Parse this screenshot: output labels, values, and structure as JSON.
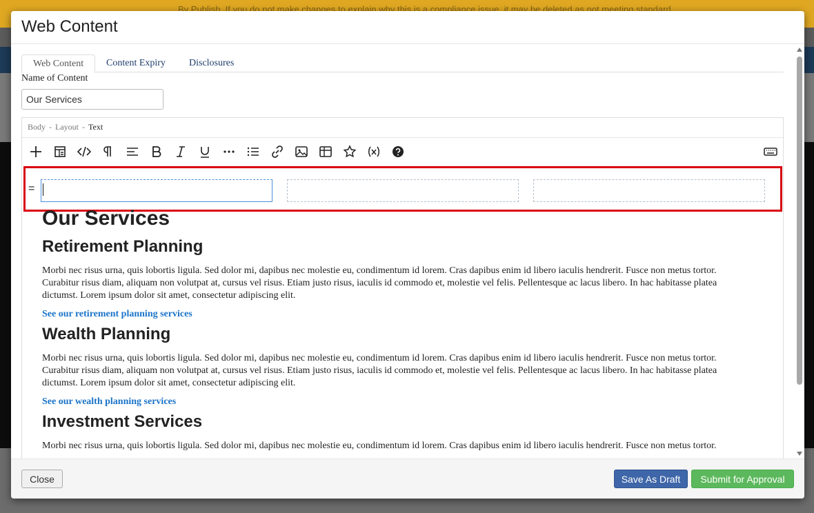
{
  "background": {
    "banner_text": "By Publish. If you do not make changes to explain why this is a compliance issue, it may be deleted as not meeting standard."
  },
  "modal": {
    "title": "Web Content"
  },
  "tabs": [
    {
      "label": "Web Content",
      "active": true
    },
    {
      "label": "Content Expiry",
      "active": false
    },
    {
      "label": "Disclosures",
      "active": false
    }
  ],
  "form": {
    "name_label": "Name of Content",
    "name_value": "Our Services"
  },
  "editor": {
    "breadcrumb": [
      "Body",
      "Layout",
      "Text"
    ],
    "toolbar": [
      "plus-icon",
      "layout-icon",
      "code-icon",
      "paragraph-icon",
      "align-icon",
      "bold-icon",
      "italic-icon",
      "underline-icon",
      "more-icon",
      "list-icon",
      "link-icon",
      "image-icon",
      "table-icon",
      "star-icon",
      "variable-icon",
      "help-icon",
      "keyboard-icon"
    ],
    "drag_handle": "="
  },
  "content": {
    "title": "Our Services",
    "sections": [
      {
        "heading": "Retirement Planning",
        "body": "Morbi nec risus urna, quis lobortis ligula. Sed dolor mi, dapibus nec molestie eu, condimentum id lorem. Cras dapibus enim id libero iaculis hendrerit. Fusce non metus tortor. Curabitur risus diam, aliquam non volutpat at, cursus vel risus. Etiam justo risus, iaculis id commodo et, molestie vel felis. Pellentesque ac lacus libero. In hac habitasse platea dictumst. Lorem ipsum dolor sit amet, consectetur adipiscing elit.",
        "link": "See our retirement planning services"
      },
      {
        "heading": "Wealth Planning",
        "body": "Morbi nec risus urna, quis lobortis ligula. Sed dolor mi, dapibus nec molestie eu, condimentum id lorem. Cras dapibus enim id libero iaculis hendrerit. Fusce non metus tortor. Curabitur risus diam, aliquam non volutpat at, cursus vel risus. Etiam justo risus, iaculis id commodo et, molestie vel felis. Pellentesque ac lacus libero. In hac habitasse platea dictumst. Lorem ipsum dolor sit amet, consectetur adipiscing elit.",
        "link": "See our wealth planning services"
      },
      {
        "heading": "Investment Services",
        "body": "Morbi nec risus urna, quis lobortis ligula. Sed dolor mi, dapibus nec molestie eu, condimentum id lorem. Cras dapibus enim id libero iaculis hendrerit. Fusce non metus tortor."
      }
    ]
  },
  "footer": {
    "close_label": "Close",
    "draft_label": "Save As Draft",
    "submit_label": "Submit for Approval"
  },
  "colors": {
    "highlight": "#d9000d",
    "link": "#1a73c8",
    "draft_button": "#3e66a8",
    "submit_button": "#5cb85c"
  }
}
